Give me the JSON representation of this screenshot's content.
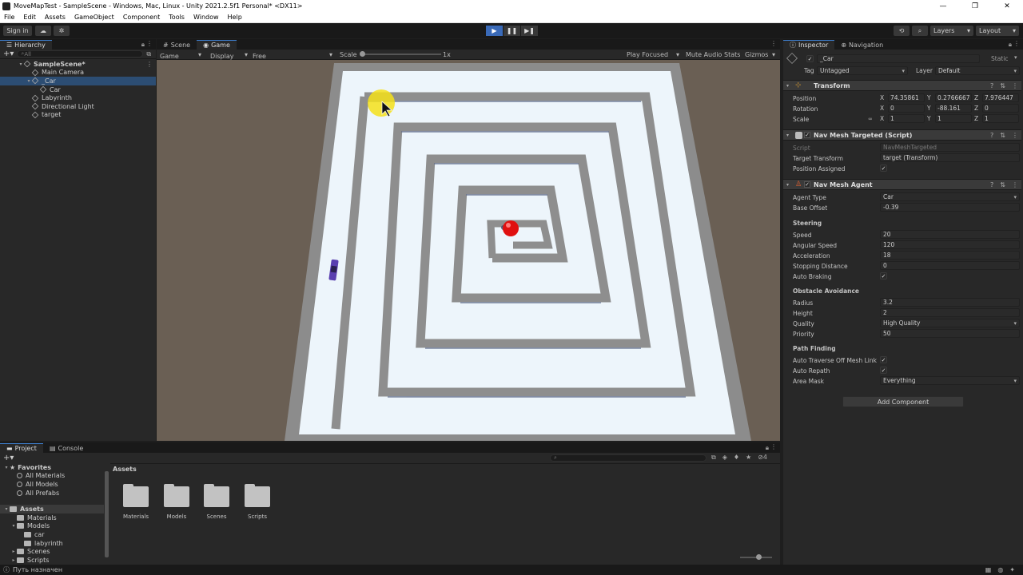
{
  "window": {
    "title": "MoveMapTest - SampleScene - Windows, Mac, Linux - Unity 2021.2.5f1 Personal* <DX11>",
    "minimize": "—",
    "maximize": "❐",
    "close": "✕"
  },
  "menu": [
    "File",
    "Edit",
    "Assets",
    "GameObject",
    "Component",
    "Tools",
    "Window",
    "Help"
  ],
  "toolbar": {
    "sign_in": "Sign in",
    "layers": "Layers",
    "layout": "Layout",
    "play": "▶",
    "pause": "❚❚",
    "step": "▶❚"
  },
  "hierarchy": {
    "tab": "Hierarchy",
    "search_placeholder": "All",
    "items": [
      {
        "label": "SampleScene*"
      },
      {
        "label": "Main Camera"
      },
      {
        "label": "_Car"
      },
      {
        "label": "Car"
      },
      {
        "label": "Labyrinth"
      },
      {
        "label": "Directional Light"
      },
      {
        "label": "target"
      }
    ]
  },
  "game": {
    "tabs": [
      "Scene",
      "Game"
    ],
    "view_mode": "Game",
    "display": "Display 1",
    "aspect": "Free Aspect",
    "scale_label": "Scale",
    "scale_value": "1x",
    "play_focused": "Play Focused",
    "mute_audio": "Mute Audio",
    "stats": "Stats",
    "gizmos": "Gizmos"
  },
  "inspector": {
    "tabs": [
      "Inspector",
      "Navigation"
    ],
    "object_name": "_Car",
    "static_label": "Static",
    "tag_label": "Tag",
    "tag_value": "Untagged",
    "layer_label": "Layer",
    "layer_value": "Default",
    "transform": {
      "title": "Transform",
      "position_label": "Position",
      "rotation_label": "Rotation",
      "scale_label": "Scale",
      "position": [
        "74.35861",
        "0.2766667",
        "7.976447"
      ],
      "rotation": [
        "0",
        "-88.161",
        "0"
      ],
      "scale": [
        "1",
        "1",
        "1"
      ]
    },
    "nav_targeted": {
      "title": "Nav Mesh Targeted (Script)",
      "script_label": "Script",
      "script_value": "NavMeshTargeted",
      "target_label": "Target Transform",
      "target_value": "target (Transform)",
      "assigned_label": "Position Assigned"
    },
    "agent": {
      "title": "Nav Mesh Agent",
      "agent_type_label": "Agent Type",
      "agent_type": "Car",
      "base_offset_label": "Base Offset",
      "base_offset": "-0.39",
      "steering_title": "Steering",
      "speed_label": "Speed",
      "speed": "20",
      "angular_label": "Angular Speed",
      "angular": "120",
      "accel_label": "Acceleration",
      "accel": "18",
      "stopping_label": "Stopping Distance",
      "stopping": "0",
      "braking_label": "Auto Braking",
      "obstacle_title": "Obstacle Avoidance",
      "radius_label": "Radius",
      "radius": "3.2",
      "height_label": "Height",
      "height": "2",
      "quality_label": "Quality",
      "quality": "High Quality",
      "priority_label": "Priority",
      "priority": "50",
      "pathfinding_title": "Path Finding",
      "traverse_label": "Auto Traverse Off Mesh Link",
      "repath_label": "Auto Repath",
      "area_label": "Area Mask",
      "area": "Everything"
    },
    "add_component": "Add Component"
  },
  "project": {
    "tabs": [
      "Project",
      "Console"
    ],
    "favorites_title": "Favorites",
    "favorites": [
      "All Materials",
      "All Models",
      "All Prefabs"
    ],
    "assets_root": "Assets",
    "tree": [
      "Materials",
      "Models",
      "car",
      "labyrinth",
      "Scenes",
      "Scripts"
    ],
    "breadcrumb": "Assets",
    "folders": [
      "Materials",
      "Models",
      "Scenes",
      "Scripts"
    ],
    "hidden_count": "4"
  },
  "status": "Путь назначен",
  "colors": {
    "accent": "#3e7fcf",
    "play_active": "#3a6ab8",
    "selection": "#2c4d73",
    "target_ball": "#e01010",
    "cursor_highlight": "#f4e11a",
    "car": "#5a3fb0"
  }
}
